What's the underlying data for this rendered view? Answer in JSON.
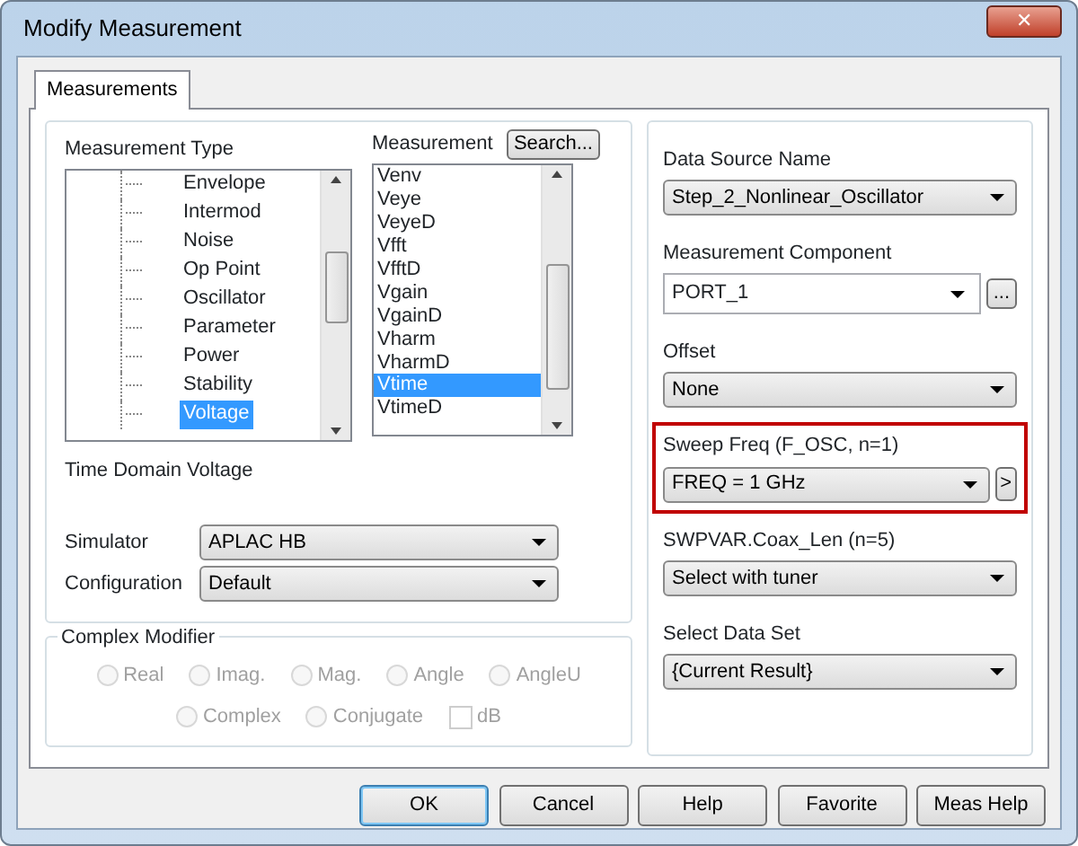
{
  "window": {
    "title": "Modify Measurement",
    "close": "✕"
  },
  "tabs": [
    {
      "label": "Measurements",
      "selected": true
    }
  ],
  "measurement_type": {
    "label": "Measurement Type",
    "items": [
      {
        "label": "Envelope",
        "selected": false
      },
      {
        "label": "Intermod",
        "selected": false
      },
      {
        "label": "Noise",
        "selected": false
      },
      {
        "label": "Op Point",
        "selected": false
      },
      {
        "label": "Oscillator",
        "selected": false
      },
      {
        "label": "Parameter",
        "selected": false
      },
      {
        "label": "Power",
        "selected": false
      },
      {
        "label": "Stability",
        "selected": false
      },
      {
        "label": "Voltage",
        "selected": true
      }
    ]
  },
  "measurement": {
    "label": "Measurement",
    "search_button": "Search...",
    "items": [
      {
        "label": "Venv",
        "selected": false
      },
      {
        "label": "Veye",
        "selected": false
      },
      {
        "label": "VeyeD",
        "selected": false
      },
      {
        "label": "Vfft",
        "selected": false
      },
      {
        "label": "VfftD",
        "selected": false
      },
      {
        "label": "Vgain",
        "selected": false
      },
      {
        "label": "VgainD",
        "selected": false
      },
      {
        "label": "Vharm",
        "selected": false
      },
      {
        "label": "VharmD",
        "selected": false
      },
      {
        "label": "Vtime",
        "selected": true
      },
      {
        "label": "VtimeD",
        "selected": false
      }
    ]
  },
  "description": "Time Domain Voltage",
  "simulator": {
    "label": "Simulator",
    "value": "APLAC HB"
  },
  "configuration": {
    "label": "Configuration",
    "value": "Default"
  },
  "complex_modifier": {
    "title": "Complex Modifier",
    "options": [
      {
        "label": "Real",
        "kind": "radio",
        "checked": false,
        "disabled": true
      },
      {
        "label": "Imag.",
        "kind": "radio",
        "checked": false,
        "disabled": true
      },
      {
        "label": "Mag.",
        "kind": "radio",
        "checked": false,
        "disabled": true
      },
      {
        "label": "Angle",
        "kind": "radio",
        "checked": false,
        "disabled": true
      },
      {
        "label": "AngleU",
        "kind": "radio",
        "checked": false,
        "disabled": true
      },
      {
        "label": "Complex",
        "kind": "radio",
        "checked": false,
        "disabled": true
      },
      {
        "label": "Conjugate",
        "kind": "radio",
        "checked": false,
        "disabled": true
      },
      {
        "label": "dB",
        "kind": "checkbox",
        "checked": false,
        "disabled": true
      }
    ]
  },
  "right_fields": [
    {
      "kind": "select",
      "label": "Data Source Name",
      "value": "Step_2_Nonlinear_Oscillator",
      "highlighted": false
    },
    {
      "kind": "combo",
      "label": "Measurement Component",
      "value": "PORT_1",
      "button": "...",
      "highlighted": false
    },
    {
      "kind": "select",
      "label": "Offset",
      "value": "None",
      "highlighted": false
    },
    {
      "kind": "sweep",
      "label": "Sweep Freq  (F_OSC, n=1)",
      "value": "FREQ = 1 GHz",
      "button": ">",
      "highlighted": true
    },
    {
      "kind": "select",
      "label": "SWPVAR.Coax_Len  (n=5)",
      "value": "Select with tuner",
      "highlighted": false
    },
    {
      "kind": "select",
      "label": "Select Data Set",
      "value": "{Current Result}",
      "highlighted": false
    }
  ],
  "buttons": [
    {
      "label": "OK",
      "default": true
    },
    {
      "label": "Cancel",
      "default": false
    },
    {
      "label": "Help",
      "default": false
    },
    {
      "label": "Favorite",
      "default": false
    },
    {
      "label": "Meas Help",
      "default": false
    }
  ]
}
